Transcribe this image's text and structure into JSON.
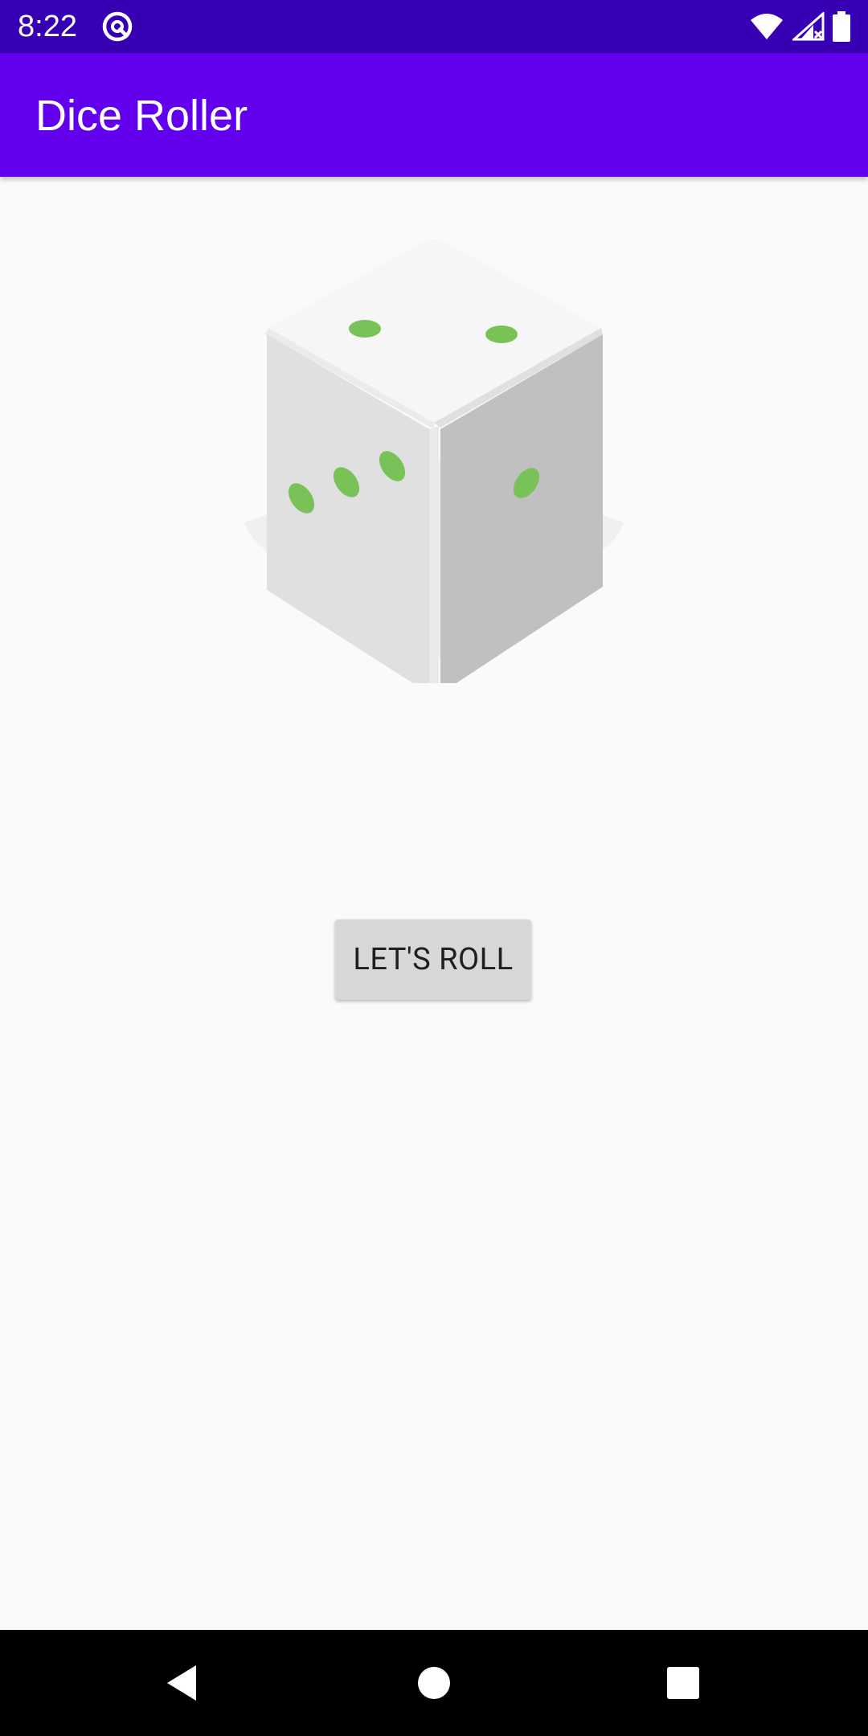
{
  "status_bar": {
    "time": "8:22",
    "background": "#3700b3"
  },
  "app_bar": {
    "title": "Dice Roller",
    "background": "#6200ee"
  },
  "main": {
    "dice_face": "dice-3-icon",
    "roll_button_label": "LET'S ROLL",
    "pip_color": "#78c257"
  },
  "nav_bar": {
    "back": "back-icon",
    "home": "home-icon",
    "recents": "recents-icon"
  }
}
